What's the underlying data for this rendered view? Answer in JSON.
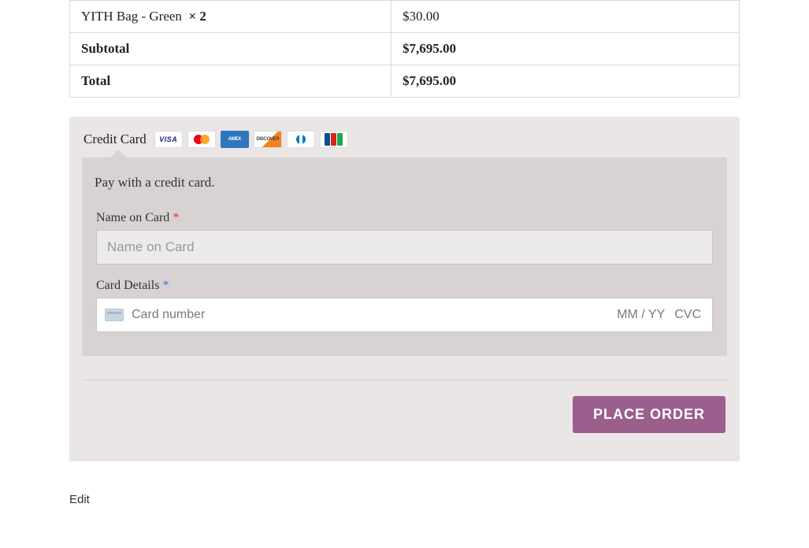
{
  "order": {
    "rows": [
      {
        "label": "YITH Bag - Green",
        "qty": "× 2",
        "price": "$30.00",
        "bold": false
      },
      {
        "label": "Subtotal",
        "qty": "",
        "price": "$7,695.00",
        "bold": true
      },
      {
        "label": "Total",
        "qty": "",
        "price": "$7,695.00",
        "bold": true
      }
    ]
  },
  "payment": {
    "method_label": "Credit Card",
    "card_brands": [
      "visa",
      "mastercard",
      "amex",
      "discover",
      "diners",
      "jcb"
    ],
    "description": "Pay with a credit card.",
    "name_on_card": {
      "label": "Name on Card",
      "required": "*",
      "placeholder": "Name on Card",
      "value": ""
    },
    "card_details": {
      "label": "Card Details",
      "required": "*",
      "number_placeholder": "Card number",
      "expiry_placeholder": "MM / YY",
      "cvc_placeholder": "CVC"
    },
    "submit_label": "PLACE ORDER"
  },
  "footer": {
    "edit_label": "Edit"
  },
  "colors": {
    "accent": "#9b5f8e",
    "panel": "#eae6e6",
    "panel_inner": "#d8d2d2"
  }
}
